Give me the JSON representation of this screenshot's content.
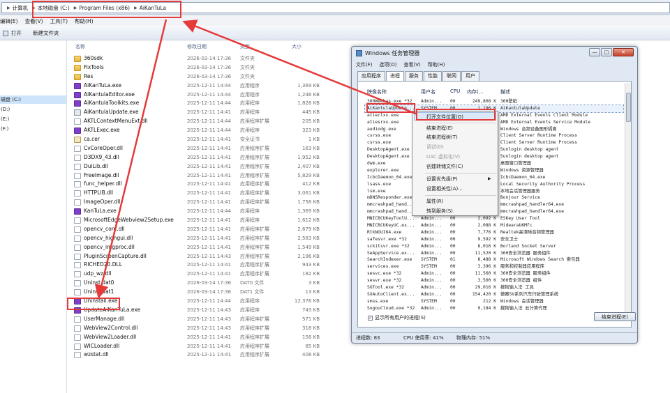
{
  "explorer": {
    "breadcrumb": [
      "计算机",
      "本地磁盘 (C:)",
      "Program Files (x86)",
      "AiKanTuLa"
    ],
    "menu": [
      "编辑(E)",
      "查看(V)",
      "工具(T)",
      "帮助(H)"
    ],
    "toolbar": {
      "open": "打开",
      "new_folder": "新建文件夹"
    },
    "nav": [
      "磁盘 (C:)",
      "(D:)",
      "(E:)",
      "(F:)"
    ],
    "columns": {
      "name": "名称",
      "date": "修改日期",
      "type": "类型",
      "size": "大小"
    },
    "files": [
      {
        "icon": "folder",
        "name": "360sdk",
        "date": "2026-03-14 17:36",
        "type": "文件夹",
        "size": ""
      },
      {
        "icon": "folder",
        "name": "FixTools",
        "date": "2026-03-14 17:36",
        "type": "文件夹",
        "size": ""
      },
      {
        "icon": "folder",
        "name": "Res",
        "date": "2026-03-14 17:36",
        "type": "文件夹",
        "size": ""
      },
      {
        "icon": "exe",
        "name": "AiKanTuLa.exe",
        "date": "2025-12-11 14:44",
        "type": "应用程序",
        "size": "1,369 KB"
      },
      {
        "icon": "exe",
        "name": "AiKantulaEditor.exe",
        "date": "2025-12-11 14:44",
        "type": "应用程序",
        "size": "1,246 KB"
      },
      {
        "icon": "exe",
        "name": "AiKantulaToolkits.exe",
        "date": "2025-12-11 14:44",
        "type": "应用程序",
        "size": "1,826 KB"
      },
      {
        "icon": "upd",
        "name": "AiKantulaUpdate.exe",
        "date": "2025-12-11 14:41",
        "type": "应用程序",
        "size": "445 KB"
      },
      {
        "icon": "file",
        "name": "AKTLContextMenuExt.dll",
        "date": "2025-12-11 14:44",
        "type": "应用程序扩展",
        "size": "205 KB"
      },
      {
        "icon": "exe",
        "name": "AKTLExec.exe",
        "date": "2025-12-11 14:44",
        "type": "应用程序",
        "size": "323 KB"
      },
      {
        "icon": "cert",
        "name": "ca.cer",
        "date": "2025-12-11 14:41",
        "type": "安全证书",
        "size": "1 KB"
      },
      {
        "icon": "file",
        "name": "CvCoreOper.dll",
        "date": "2025-12-11 14:41",
        "type": "应用程序扩展",
        "size": "163 KB"
      },
      {
        "icon": "file",
        "name": "D3DX9_43.dll",
        "date": "2025-12-11 14:41",
        "type": "应用程序扩展",
        "size": "1,952 KB"
      },
      {
        "icon": "file",
        "name": "DuiLib.dll",
        "date": "2025-12-11 14:41",
        "type": "应用程序扩展",
        "size": "2,407 KB"
      },
      {
        "icon": "file",
        "name": "FreeImage.dll",
        "date": "2025-12-11 14:41",
        "type": "应用程序扩展",
        "size": "5,829 KB"
      },
      {
        "icon": "file",
        "name": "func_helper.dll",
        "date": "2025-12-11 14:41",
        "type": "应用程序扩展",
        "size": "412 KB"
      },
      {
        "icon": "file",
        "name": "HTTPLIB.dll",
        "date": "2025-12-11 14:41",
        "type": "应用程序扩展",
        "size": "3,061 KB"
      },
      {
        "icon": "file",
        "name": "ImageOper.dll",
        "date": "2025-12-11 14:41",
        "type": "应用程序扩展",
        "size": "1,758 KB"
      },
      {
        "icon": "exe",
        "name": "KanTuLa.exe",
        "date": "2025-12-11 14:44",
        "type": "应用程序",
        "size": "1,369 KB"
      },
      {
        "icon": "file",
        "name": "MicrosoftEdgeWebview2Setup.exe",
        "date": "2025-12-11 14:41",
        "type": "应用程序",
        "size": "1,612 KB"
      },
      {
        "icon": "file",
        "name": "opencv_core.dll",
        "date": "2025-12-11 14:41",
        "type": "应用程序扩展",
        "size": "2,679 KB"
      },
      {
        "icon": "file",
        "name": "opencv_highgui.dll",
        "date": "2025-12-11 14:41",
        "type": "应用程序扩展",
        "size": "2,583 KB"
      },
      {
        "icon": "file",
        "name": "opencv_imgproc.dll",
        "date": "2025-12-11 14:41",
        "type": "应用程序扩展",
        "size": "1,549 KB"
      },
      {
        "icon": "file",
        "name": "PluginScreenCapture.dll",
        "date": "2025-12-11 14:43",
        "type": "应用程序扩展",
        "size": "2,196 KB"
      },
      {
        "icon": "file",
        "name": "RICHED20.DLL",
        "date": "2025-12-11 14:41",
        "type": "应用程序扩展",
        "size": "943 KB"
      },
      {
        "icon": "file",
        "name": "udp_wz.dll",
        "date": "2025-12-11 14:41",
        "type": "应用程序扩展",
        "size": "182 KB"
      },
      {
        "icon": "file",
        "name": "Uninst.dat0",
        "date": "2026-03-14 17:36",
        "type": "DAT0 文件",
        "size": "3 KB"
      },
      {
        "icon": "file",
        "name": "Uninst.dat1",
        "date": "2026-03-14 17:36",
        "type": "DAT1 文件",
        "size": "13 KB"
      },
      {
        "icon": "exe",
        "name": "Uninstall.exe",
        "date": "2025-12-11 14:44",
        "type": "应用程序",
        "size": "12,376 KB"
      },
      {
        "icon": "exe",
        "name": "UpdateAiKanTuLa.exe",
        "date": "2025-12-11 14:43",
        "type": "应用程序",
        "size": "743 KB"
      },
      {
        "icon": "file",
        "name": "UserManage.dll",
        "date": "2025-12-11 14:43",
        "type": "应用程序扩展",
        "size": "571 KB"
      },
      {
        "icon": "file",
        "name": "WebView2Control.dll",
        "date": "2025-12-11 14:43",
        "type": "应用程序扩展",
        "size": "318 KB"
      },
      {
        "icon": "file",
        "name": "WebView2Loader.dll",
        "date": "2025-12-11 14:41",
        "type": "应用程序扩展",
        "size": "158 KB"
      },
      {
        "icon": "file",
        "name": "WICLoader.dll",
        "date": "2025-12-11 14:41",
        "type": "应用程序扩展",
        "size": "85 KB"
      },
      {
        "icon": "file",
        "name": "wzstat.dll",
        "date": "2025-12-11 14:41",
        "type": "应用程序扩展",
        "size": "408 KB"
      }
    ]
  },
  "taskmgr": {
    "title": "Windows 任务管理器",
    "window_controls": [
      "—",
      "□",
      "✕"
    ],
    "menu": [
      "文件(F)",
      "选项(O)",
      "查看(V)",
      "帮助(H)"
    ],
    "tabs": [
      "应用程序",
      "进程",
      "服务",
      "性能",
      "联网",
      "用户"
    ],
    "active_tab": "进程",
    "columns": [
      "映像名称",
      "用户名",
      "CPU",
      "内存(...",
      "描述"
    ],
    "processes": [
      [
        "360Weebas.exe *32",
        "Admin...",
        "00",
        "249,808 K",
        "360壁纸"
      ],
      [
        "AiKantulaUpdate...",
        "SYSTEM",
        "00",
        "1,196 K",
        "AiKantulaUpdate"
      ],
      [
        "atieclxx.exe",
        "",
        "",
        "",
        "AMD External Events Client Module"
      ],
      [
        "atiesrxx.exe",
        "",
        "",
        "",
        "AMD External Events Service Module"
      ],
      [
        "audiodg.exe",
        "",
        "",
        "",
        "Windows 音频设备图形隔离"
      ],
      [
        "csrss.exe",
        "",
        "",
        "",
        "Client Server Runtime Process"
      ],
      [
        "csrss.exe",
        "",
        "",
        "",
        "Client Server Runtime Process"
      ],
      [
        "DesktopAgent.exe",
        "",
        "",
        "",
        "Sunlogin desktop agent"
      ],
      [
        "DesktopAgent.exe",
        "",
        "",
        "",
        "Sunlogin desktop agent"
      ],
      [
        "dwm.exe",
        "",
        "",
        "",
        "桌面窗口管理器"
      ],
      [
        "explorer.exe",
        "",
        "",
        "",
        "Windows 资源管理器"
      ],
      [
        "IcbcDaemon_64.exe",
        "",
        "",
        "",
        "IcbcDaemon_64.exe"
      ],
      [
        "lsass.exe",
        "",
        "",
        "",
        "Local Security Authority Process"
      ],
      [
        "lsm.exe",
        "",
        "",
        "",
        "本地会话管理器服务"
      ],
      [
        "mDNSResponder.exe",
        "",
        "",
        "",
        "Bonjour Service"
      ],
      [
        "mmcrashpad_hand...",
        "",
        "",
        "",
        "mmcrashpad_handler64.exe"
      ],
      [
        "mmcrashpad_hand...",
        "",
        "",
        "",
        "mmcrashpad_handler64.exe"
      ],
      [
        "MNICBCUKeyToolU...",
        "Admin...",
        "00",
        "2,092 K",
        "ESKey User Tool"
      ],
      [
        "MNICBCUKeyUC.ex...",
        "Admin...",
        "00",
        "2,088 K",
        "MidearaUKMfc"
      ],
      [
        "RtkNGUI64.exe",
        "Admin...",
        "00",
        "7,776 K",
        "Realtek高清晰音频管理器"
      ],
      [
        "safesvr.exe *32",
        "Admin...",
        "00",
        "9,592 K",
        "安全卫士"
      ],
      [
        "sckitsvr.exe *32",
        "Admin...",
        "00",
        "8,016 K",
        "Borland Socket Server"
      ],
      [
        "SeAppService.ex...",
        "Admin...",
        "00",
        "11,520 K",
        "360安全浏览器 服务组件"
      ],
      [
        "SearchIndexer.exe",
        "SYSTEM",
        "01",
        "8,488 K",
        "Microsoft Windows Search 索引器"
      ],
      [
        "services.exe",
        "SYSTEM",
        "00",
        "3,396 K",
        "服务和控制器应用程序"
      ],
      [
        "sesvc.exe *32",
        "Admin...",
        "00",
        "11,560 K",
        "360安全浏览器 服务组件"
      ],
      [
        "sesvr.exe *32",
        "Admin...",
        "00",
        "3,500 K",
        "360安全浏览器 组件"
      ],
      [
        "SGTool.exe *32",
        "Admin...",
        "00",
        "29,016 K",
        "搜狗输入法 工具"
      ],
      [
        "SXAutoClient.ex...",
        "Admin...",
        "00",
        "154,420 K",
        "德赛SV系列汽车行驶管理系统"
      ],
      [
        "smss.exe",
        "SYSTEM",
        "00",
        "212 K",
        "Windows 会话管理器"
      ],
      [
        "SogouCloud.exe *32",
        "Admin...",
        "00",
        "9,184 K",
        "搜狗输入法 云计算代理"
      ]
    ],
    "show_all_label": "显示所有用户的进程(S)",
    "end_process_label": "结束进程(E)",
    "status": {
      "processes": "进程数: 83",
      "cpu": "CPU 使用率: 41%",
      "memory": "物理内存: 51%"
    }
  },
  "context_menu": {
    "items": [
      "打开文件位置(O)",
      "结束进程(E)",
      "结束进程树(T)",
      "调试(D)",
      "UAC 虚拟化(V)",
      "创建转储文件(C)",
      "设置优先级(P)",
      "设置相关性(A)...",
      "属性(R)",
      "转到服务(S)"
    ],
    "disabled": [
      "调试(D)",
      "UAC 虚拟化(V)"
    ],
    "submenu_arrow": "▶"
  },
  "colors": {
    "highlight_red": "#e53a3a",
    "exe_icon": "#7e3fc9"
  }
}
